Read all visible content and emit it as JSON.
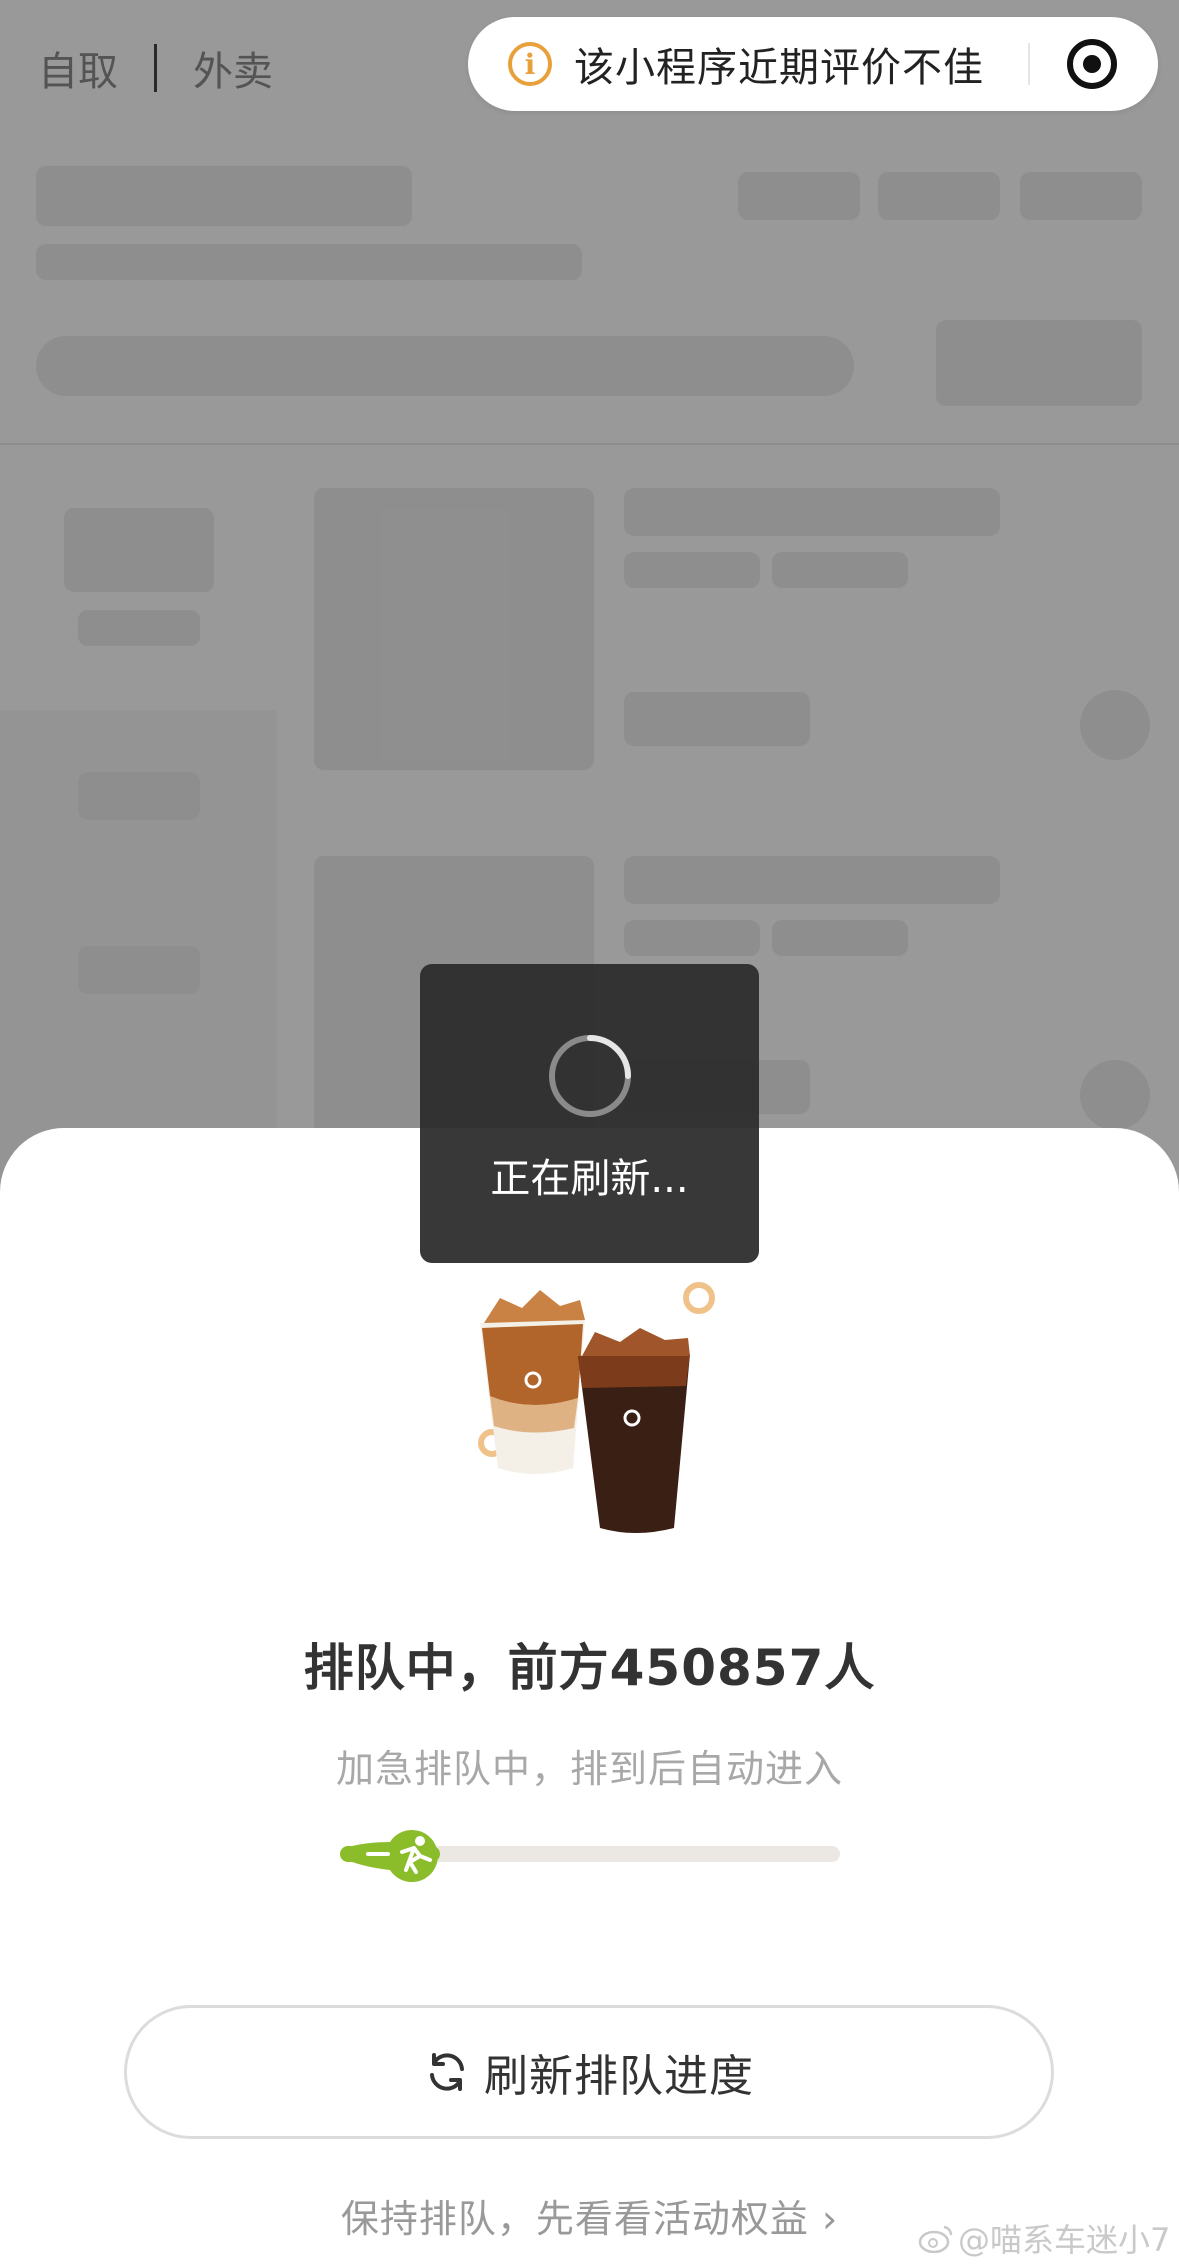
{
  "topnav": {
    "pickup": "自取",
    "delivery": "外卖"
  },
  "notice": {
    "text": "该小程序近期评价不佳",
    "info_icon": "info-icon",
    "menu_icon": "target-icon"
  },
  "toast": {
    "text": "正在刷新..."
  },
  "queue": {
    "headline": "排队中，前方450857人",
    "subline": "加急排队中，排到后自动进入",
    "progress": 0.2
  },
  "buttons": {
    "refresh": "刷新排队进度"
  },
  "link": {
    "keep": "保持排队，先看看活动权益 ›"
  },
  "watermark": {
    "text": "@喵系车迷小7"
  },
  "colors": {
    "accent_green": "#8bbd2a",
    "warning_orange": "#e8a13a",
    "track": "#ebe8e3"
  }
}
